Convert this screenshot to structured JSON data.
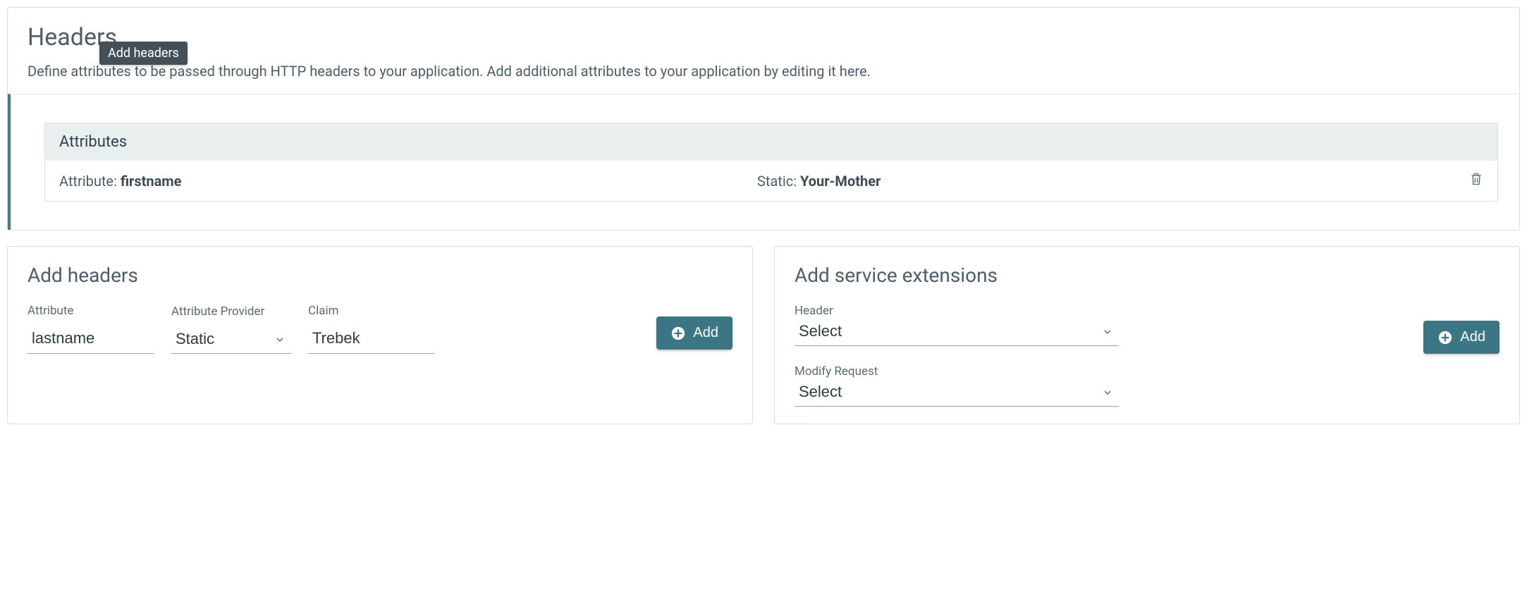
{
  "section": {
    "title": "Headers",
    "tooltip": "Add headers",
    "description": "Define attributes to be passed through HTTP headers to your application. Add additional attributes to your application by editing it here."
  },
  "attributes": {
    "header": "Attributes",
    "rows": [
      {
        "attr_label": "Attribute: ",
        "attr_value": "firstname",
        "static_label": "Static: ",
        "static_value": "Your-Mother"
      }
    ]
  },
  "add_headers": {
    "title": "Add headers",
    "fields": {
      "attribute_label": "Attribute",
      "attribute_value": "lastname",
      "provider_label": "Attribute Provider",
      "provider_value": "Static",
      "claim_label": "Claim",
      "claim_value": "Trebek"
    },
    "add_button": "Add"
  },
  "extensions": {
    "title": "Add service extensions",
    "header_label": "Header",
    "header_value": "Select",
    "modify_label": "Modify Request",
    "modify_value": "Select",
    "add_button": "Add"
  }
}
